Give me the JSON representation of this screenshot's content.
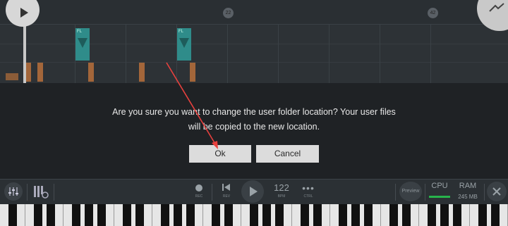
{
  "timeline": {
    "markers": [
      "22",
      "42"
    ],
    "note_labels": [
      "FL",
      "FL"
    ]
  },
  "dialog": {
    "message_line1": "Are you sure you want to change the user folder location? Your user files",
    "message_line2": "will be copied to the new location.",
    "ok_label": "Ok",
    "cancel_label": "Cancel"
  },
  "toolbar": {
    "rec_label": "REC",
    "rev_label": "REV",
    "tempo_value": "122",
    "bpm_label": "BPM",
    "ctrl_label": "CTRL",
    "preview_label": "Preview",
    "cpu_label": "CPU",
    "ram_label": "RAM",
    "ram_value": "245 MB"
  },
  "colors": {
    "dialog_bg": "#1f2225",
    "note_teal": "#2f8c8a",
    "note_brown": "#a3663a",
    "cpu_bar": "#27b34b",
    "annotation_arrow": "#e8413e"
  },
  "icons": [
    "play-icon",
    "mixer-icon",
    "piano-roll-icon",
    "stop-icon",
    "rewind-icon",
    "play-icon",
    "more-icon",
    "close-icon"
  ]
}
